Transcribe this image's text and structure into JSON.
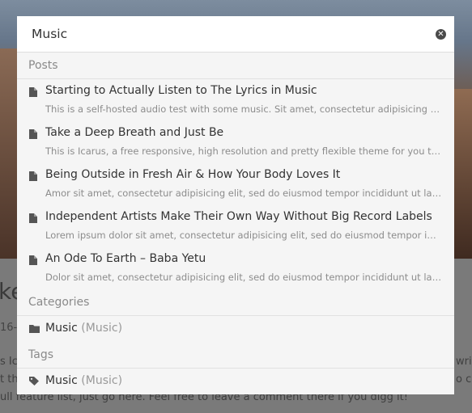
{
  "background": {
    "title_fragment": "ke",
    "date_fragment": "16-",
    "lines_left": [
      "s Ic",
      "t th",
      "ull feature list, just go here. Feel free to leave a comment there if you digg it!"
    ],
    "lines_right": [
      "writ",
      "o c"
    ]
  },
  "search": {
    "query": "Music",
    "placeholder": "",
    "clear_icon": "close-circle-icon"
  },
  "sections": {
    "posts": {
      "heading": "Posts",
      "items": [
        {
          "title": "Starting to Actually Listen to The Lyrics in Music",
          "excerpt": "This is a self-hosted audio test with some music. Sit amet, consectetur adipisicing elit, sed do eiusmod tempor incididunt"
        },
        {
          "title": "Take a Deep Breath and Just Be",
          "excerpt": "This is Icarus, a free responsive, high resolution and pretty flexible theme for you to use on your blog"
        },
        {
          "title": "Being Outside in Fresh Air & How Your Body Loves It",
          "excerpt": "Amor sit amet, consectetur adipisicing elit, sed do eiusmod tempor incididunt ut labore et dolore"
        },
        {
          "title": "Independent Artists Make Their Own Way Without Big Record Labels",
          "excerpt": "Lorem ipsum dolor sit amet, consectetur adipisicing elit, sed do eiusmod tempor incididunt ut labore"
        },
        {
          "title": "An Ode To Earth – Baba Yetu",
          "excerpt": "Dolor sit amet, consectetur adipisicing elit, sed do eiusmod tempor incididunt ut labore et dolore"
        }
      ]
    },
    "categories": {
      "heading": "Categories",
      "items": [
        {
          "name": "Music",
          "count": "(Music)"
        }
      ]
    },
    "tags": {
      "heading": "Tags",
      "items": [
        {
          "name": "Music",
          "count": "(Music)"
        }
      ]
    }
  },
  "colors": {
    "overlay": "#6f6f6f",
    "modal_bg": "#f5f5f5",
    "text": "#333333",
    "muted": "#8c8c8c",
    "icon": "#555555"
  },
  "icons": {
    "post": "document-icon",
    "category": "folder-icon",
    "tag": "tag-icon"
  }
}
